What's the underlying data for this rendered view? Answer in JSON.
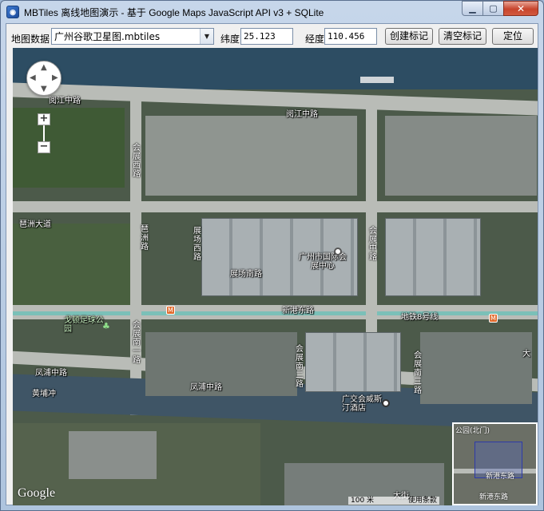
{
  "window": {
    "title": "MBTiles 离线地图演示 - 基于 Google Maps JavaScript API v3 + SQLite",
    "app_icon": "globe-icon",
    "min_glyph": "▁",
    "max_glyph": "▢",
    "close_glyph": "✕"
  },
  "toolbar": {
    "map_data_label": "地图数据",
    "map_file_selected": "广州谷歌卫星图.mbtiles",
    "latitude_label": "纬度",
    "latitude_value": "25.123",
    "longitude_label": "经度",
    "longitude_value": "110.456",
    "create_marker_button": "创建标记",
    "clear_markers_button": "清空标记",
    "locate_button": "定位"
  },
  "map": {
    "zoom_in": "+",
    "zoom_out": "−",
    "google_logo": "Google",
    "scale_text": "100 米",
    "terms_text": "使用条款",
    "labels": {
      "yuejiang_road_top_left": "阅江中路",
      "yuejiang_road_center": "阅江中路",
      "huizhou_avenue": "琶洲大道",
      "xingang_east_road": "新港东路",
      "metro_line_8": "地铁8号线",
      "fengpu_road": "凤浦中路",
      "fengpu_road_left": "凤浦中路",
      "huangpuchong": "黄埔冲",
      "zhanchang_south_road": "展场南路",
      "expo_center": "广州市国际会展中心",
      "football_park": "戈顿足球公园",
      "hotel": "广交会威斯汀酒店",
      "big_edge": "大",
      "dajie": "大街"
    },
    "vertical_labels": {
      "huizhan_west_road": "会展西路",
      "huizhan_middle_road": "会展中路",
      "zhanchang_west_road": "展场西路",
      "huizhan_south_road_1": "会展南一路",
      "huizhan_south_road_2": "会展南二路",
      "huizhan_south_road_3": "会展南三路",
      "pazhou_road": "琶洲路"
    },
    "overview": {
      "label_top": "公园(北门)",
      "label_bottom": "新港东路",
      "label_bottom_right": "新港东路"
    }
  },
  "colors": {
    "accent": "#3f7bd1",
    "close_button": "#c7452d",
    "metro_line": "#6cc0b8"
  }
}
